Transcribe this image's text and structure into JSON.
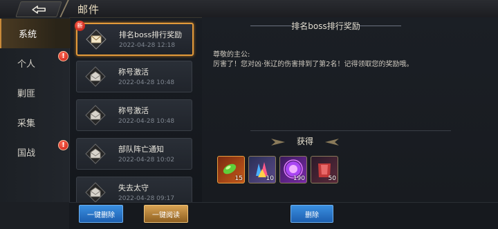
{
  "header": {
    "title": "邮件"
  },
  "tabs": [
    {
      "label": "系统",
      "active": true,
      "badge": ""
    },
    {
      "label": "个人",
      "active": false,
      "badge": "!"
    },
    {
      "label": "剿匪",
      "active": false,
      "badge": ""
    },
    {
      "label": "采集",
      "active": false,
      "badge": ""
    },
    {
      "label": "国战",
      "active": false,
      "badge": "!"
    }
  ],
  "mails": [
    {
      "title": "排名boss排行奖励",
      "date": "2022-04-28   12:18",
      "new_tag": "新",
      "icon": "open-envelope-icon"
    },
    {
      "title": "称号激活",
      "date": "2022-04-28   10:48",
      "icon": "read-envelope-icon"
    },
    {
      "title": "称号激活",
      "date": "2022-04-28   10:48",
      "icon": "read-envelope-icon"
    },
    {
      "title": "部队阵亡通知",
      "date": "2022-04-28   10:02",
      "icon": "read-envelope-icon"
    },
    {
      "title": "失去太守",
      "date": "2022-04-28   09:17",
      "icon": "read-envelope-icon"
    }
  ],
  "detail": {
    "title": "排名boss排行奖励",
    "greeting": "尊敬的主公:",
    "body": "厉害了！您对凶·张辽的伤害排到了第2名！记得领取您的奖励哦。",
    "gain_label": "获得",
    "rewards": [
      {
        "icon": "green-gem-icon",
        "count": "15",
        "color": "#c45a1a"
      },
      {
        "icon": "crystal-cluster-icon",
        "count": "10",
        "color": "#3a4a8a"
      },
      {
        "icon": "purple-orb-icon",
        "count": "190",
        "color": "#5a2a8a"
      },
      {
        "icon": "red-armor-icon",
        "count": "50",
        "color": "#4a2a3a"
      }
    ]
  },
  "actions": {
    "delete_all": "一键删除",
    "read_all": "一键阅读",
    "delete": "删除"
  },
  "colors": {
    "accent": "#e39a3b",
    "button_blue": "#2a7ad0",
    "button_gold": "#c18a3e",
    "badge_red": "#d42a1a"
  }
}
